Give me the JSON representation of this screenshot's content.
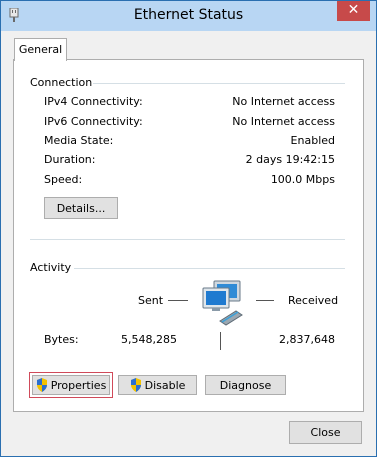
{
  "window": {
    "title": "Ethernet Status",
    "close_glyph": "✕"
  },
  "tabs": [
    {
      "label": "General"
    }
  ],
  "connection": {
    "heading": "Connection",
    "rows": [
      {
        "label": "IPv4 Connectivity:",
        "value": "No Internet access"
      },
      {
        "label": "IPv6 Connectivity:",
        "value": "No Internet access"
      },
      {
        "label": "Media State:",
        "value": "Enabled"
      },
      {
        "label": "Duration:",
        "value": "2 days 19:42:15"
      },
      {
        "label": "Speed:",
        "value": "100.0 Mbps"
      }
    ],
    "details_button": "Details..."
  },
  "activity": {
    "heading": "Activity",
    "sent_label": "Sent",
    "received_label": "Received",
    "bytes_label": "Bytes:",
    "bytes_sent": "5,548,285",
    "bytes_received": "2,837,648"
  },
  "buttons": {
    "properties": "Properties",
    "disable": "Disable",
    "diagnose": "Diagnose",
    "close": "Close"
  },
  "icons": {
    "app": "network-adapter-icon",
    "network": "network-computers-icon",
    "uac": "uac-shield-icon"
  },
  "colors": {
    "titlebar": "#b8d6f3",
    "close_button": "#c74a4a",
    "focus_outline": "#d04a5a"
  }
}
